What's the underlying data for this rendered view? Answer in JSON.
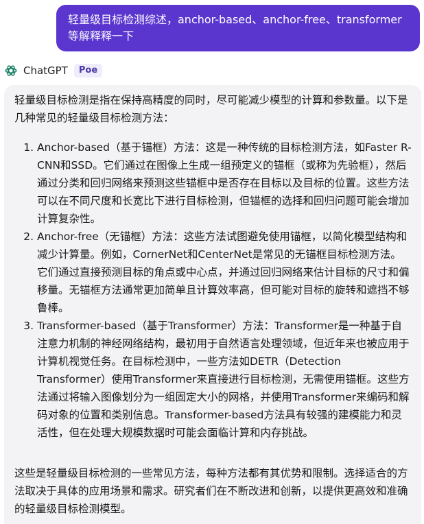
{
  "user_message": "轻量级目标检测综述，anchor-based、anchor-free、transformer等解释释一下",
  "bot": {
    "name": "ChatGPT",
    "badge": "Poe",
    "icon": "chatgpt-logo-icon",
    "intro": "轻量级目标检测是指在保持高精度的同时，尽可能减少模型的计算和参数量。以下是几种常见的轻量级目标检测方法：",
    "items": [
      {
        "num": "1.",
        "text": "Anchor-based（基于锚框）方法：这是一种传统的目标检测方法，如Faster R-CNN和SSD。它们通过在图像上生成一组预定义的锚框（或称为先验框），然后通过分类和回归网络来预测这些锚框中是否存在目标以及目标的位置。这些方法可以在不同尺度和长宽比下进行目标检测，但锚框的选择和回归问题可能会增加计算复杂性。"
      },
      {
        "num": "2.",
        "text": "Anchor-free（无锚框）方法：这些方法试图避免使用锚框，以简化模型结构和减少计算量。例如，CornerNet和CenterNet是常见的无锚框目标检测方法。它们通过直接预测目标的角点或中心点，并通过回归网络来估计目标的尺寸和偏移量。无锚框方法通常更加简单且计算效率高，但可能对目标的旋转和遮挡不够鲁棒。"
      },
      {
        "num": "3.",
        "text": "Transformer-based（基于Transformer）方法：Transformer是一种基于自注意力机制的神经网络结构，最初用于自然语言处理领域，但近年来也被应用于计算机视觉任务。在目标检测中，一些方法如DETR（Detection Transformer）使用Transformer来直接进行目标检测，无需使用锚框。这些方法通过将输入图像划分为一组固定大小的网格，并使用Transformer来编码和解码对象的位置和类别信息。Transformer-based方法具有较强的建模能力和灵活性，但在处理大规模数据时可能会面临计算和内存挑战。"
      }
    ],
    "outro": "这些是轻量级目标检测的一些常见方法，每种方法都有其优势和限制。选择适合的方法取决于具体的应用场景和需求。研究者们在不断改进和创新，以提供更高效和准确的轻量级目标检测模型。"
  },
  "colors": {
    "user_bubble": "#5a36cf",
    "bot_bubble": "#f3f3f5",
    "badge_text": "#4a3aa8",
    "logo": "#1a7f64"
  }
}
